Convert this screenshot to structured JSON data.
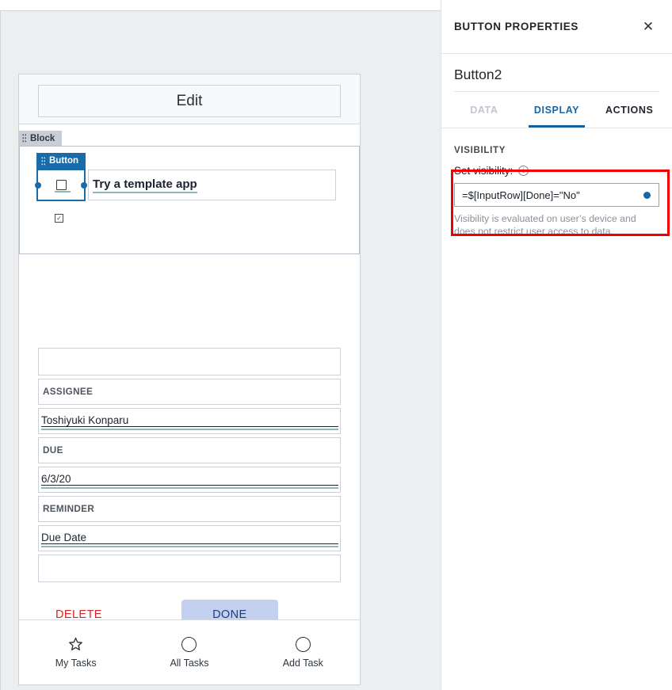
{
  "canvas": {
    "screen_title": "Edit",
    "tags": {
      "block": "Block",
      "button": "Button"
    },
    "button_widget": {
      "icon": "square-outline-icon",
      "label": "Try a template app"
    },
    "mini_icon": "checkbox-checked-icon",
    "fields": [
      {
        "kind": "blank",
        "text": ""
      },
      {
        "kind": "label",
        "text": "ASSIGNEE"
      },
      {
        "kind": "value",
        "text": "Toshiyuki Konparu"
      },
      {
        "kind": "label",
        "text": "DUE"
      },
      {
        "kind": "value",
        "text": "6/3/20"
      },
      {
        "kind": "label",
        "text": "REMINDER"
      },
      {
        "kind": "value",
        "text": "Due Date"
      },
      {
        "kind": "blank",
        "text": ""
      }
    ],
    "actions": {
      "delete_label": "DELETE",
      "done_label": "DONE"
    },
    "nav": [
      {
        "icon": "star-outline-icon",
        "label": "My Tasks"
      },
      {
        "icon": "circle-outline-icon",
        "label": "All Tasks"
      },
      {
        "icon": "circle-outline-icon",
        "label": "Add Task"
      }
    ]
  },
  "panel": {
    "header_title": "BUTTON PROPERTIES",
    "close_icon": "close-icon",
    "element_name": "Button2",
    "tabs": [
      {
        "label": "DATA",
        "state": "dim"
      },
      {
        "label": "DISPLAY",
        "state": "active"
      },
      {
        "label": "ACTIONS",
        "state": "normal"
      }
    ],
    "section_label": "VISIBILITY",
    "visibility": {
      "label": "Set visibility:",
      "info_icon": "info-icon",
      "formula": "=$[InputRow][Done]=\"No\"",
      "indicator_icon": "blue-dot-icon",
      "help_text": "Visibility is evaluated on user’s device and does not restrict user access to data."
    },
    "highlight_color": "#ee0000"
  },
  "colors": {
    "selection_blue": "#1a6ca8",
    "tab_active_blue": "#14619e",
    "delete_red": "#d32626",
    "done_bg": "#c4d0f0",
    "done_text": "#1f3d7a",
    "teal_underline": "#8fb8b4",
    "highlight_red": "#ee0000"
  }
}
